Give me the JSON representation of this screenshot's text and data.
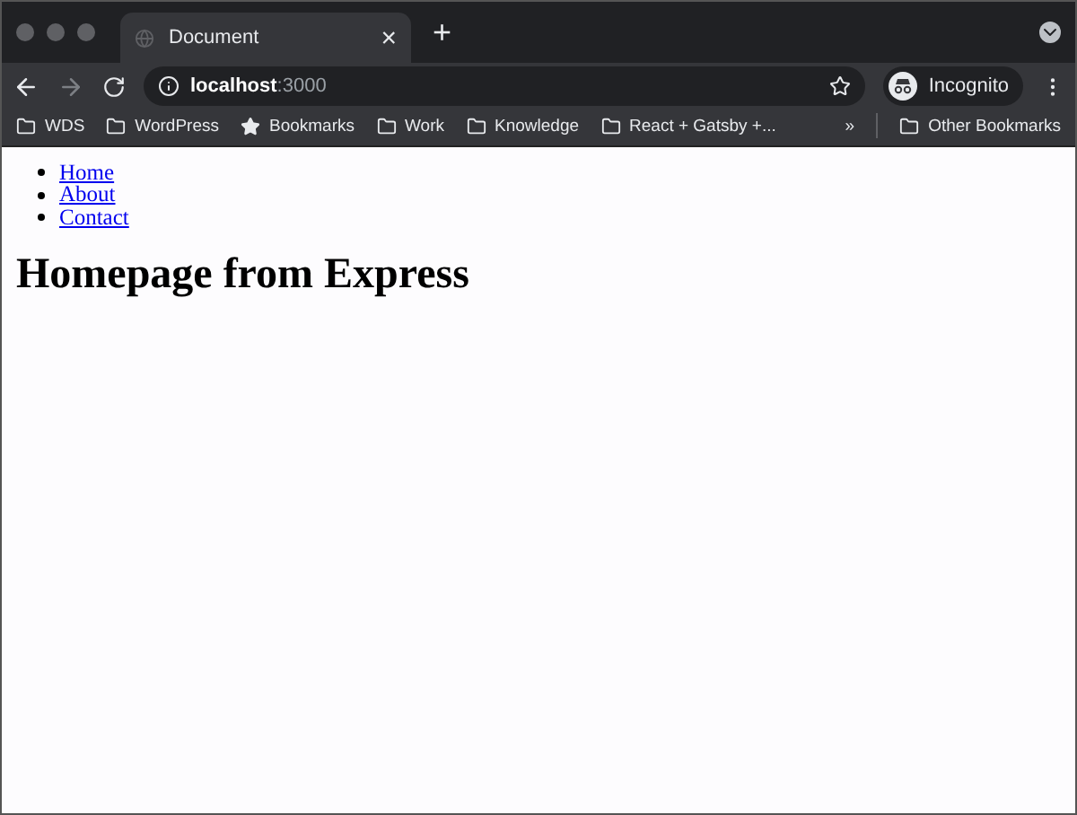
{
  "tab": {
    "title": "Document",
    "close": "×",
    "new_tab": "+"
  },
  "address": {
    "host": "localhost",
    "port": ":3000"
  },
  "profile": {
    "label": "Incognito"
  },
  "bookmarks": [
    {
      "label": "WDS",
      "kind": "folder"
    },
    {
      "label": "WordPress",
      "kind": "folder"
    },
    {
      "label": "Bookmarks",
      "kind": "star"
    },
    {
      "label": "Work",
      "kind": "folder"
    },
    {
      "label": "Knowledge",
      "kind": "folder"
    },
    {
      "label": "React + Gatsby +...",
      "kind": "folder"
    }
  ],
  "overflow": "»",
  "other_bookmarks": {
    "label": "Other Bookmarks",
    "kind": "folder"
  },
  "page": {
    "nav": [
      "Home",
      "About",
      "Contact"
    ],
    "heading": "Homepage from Express"
  }
}
